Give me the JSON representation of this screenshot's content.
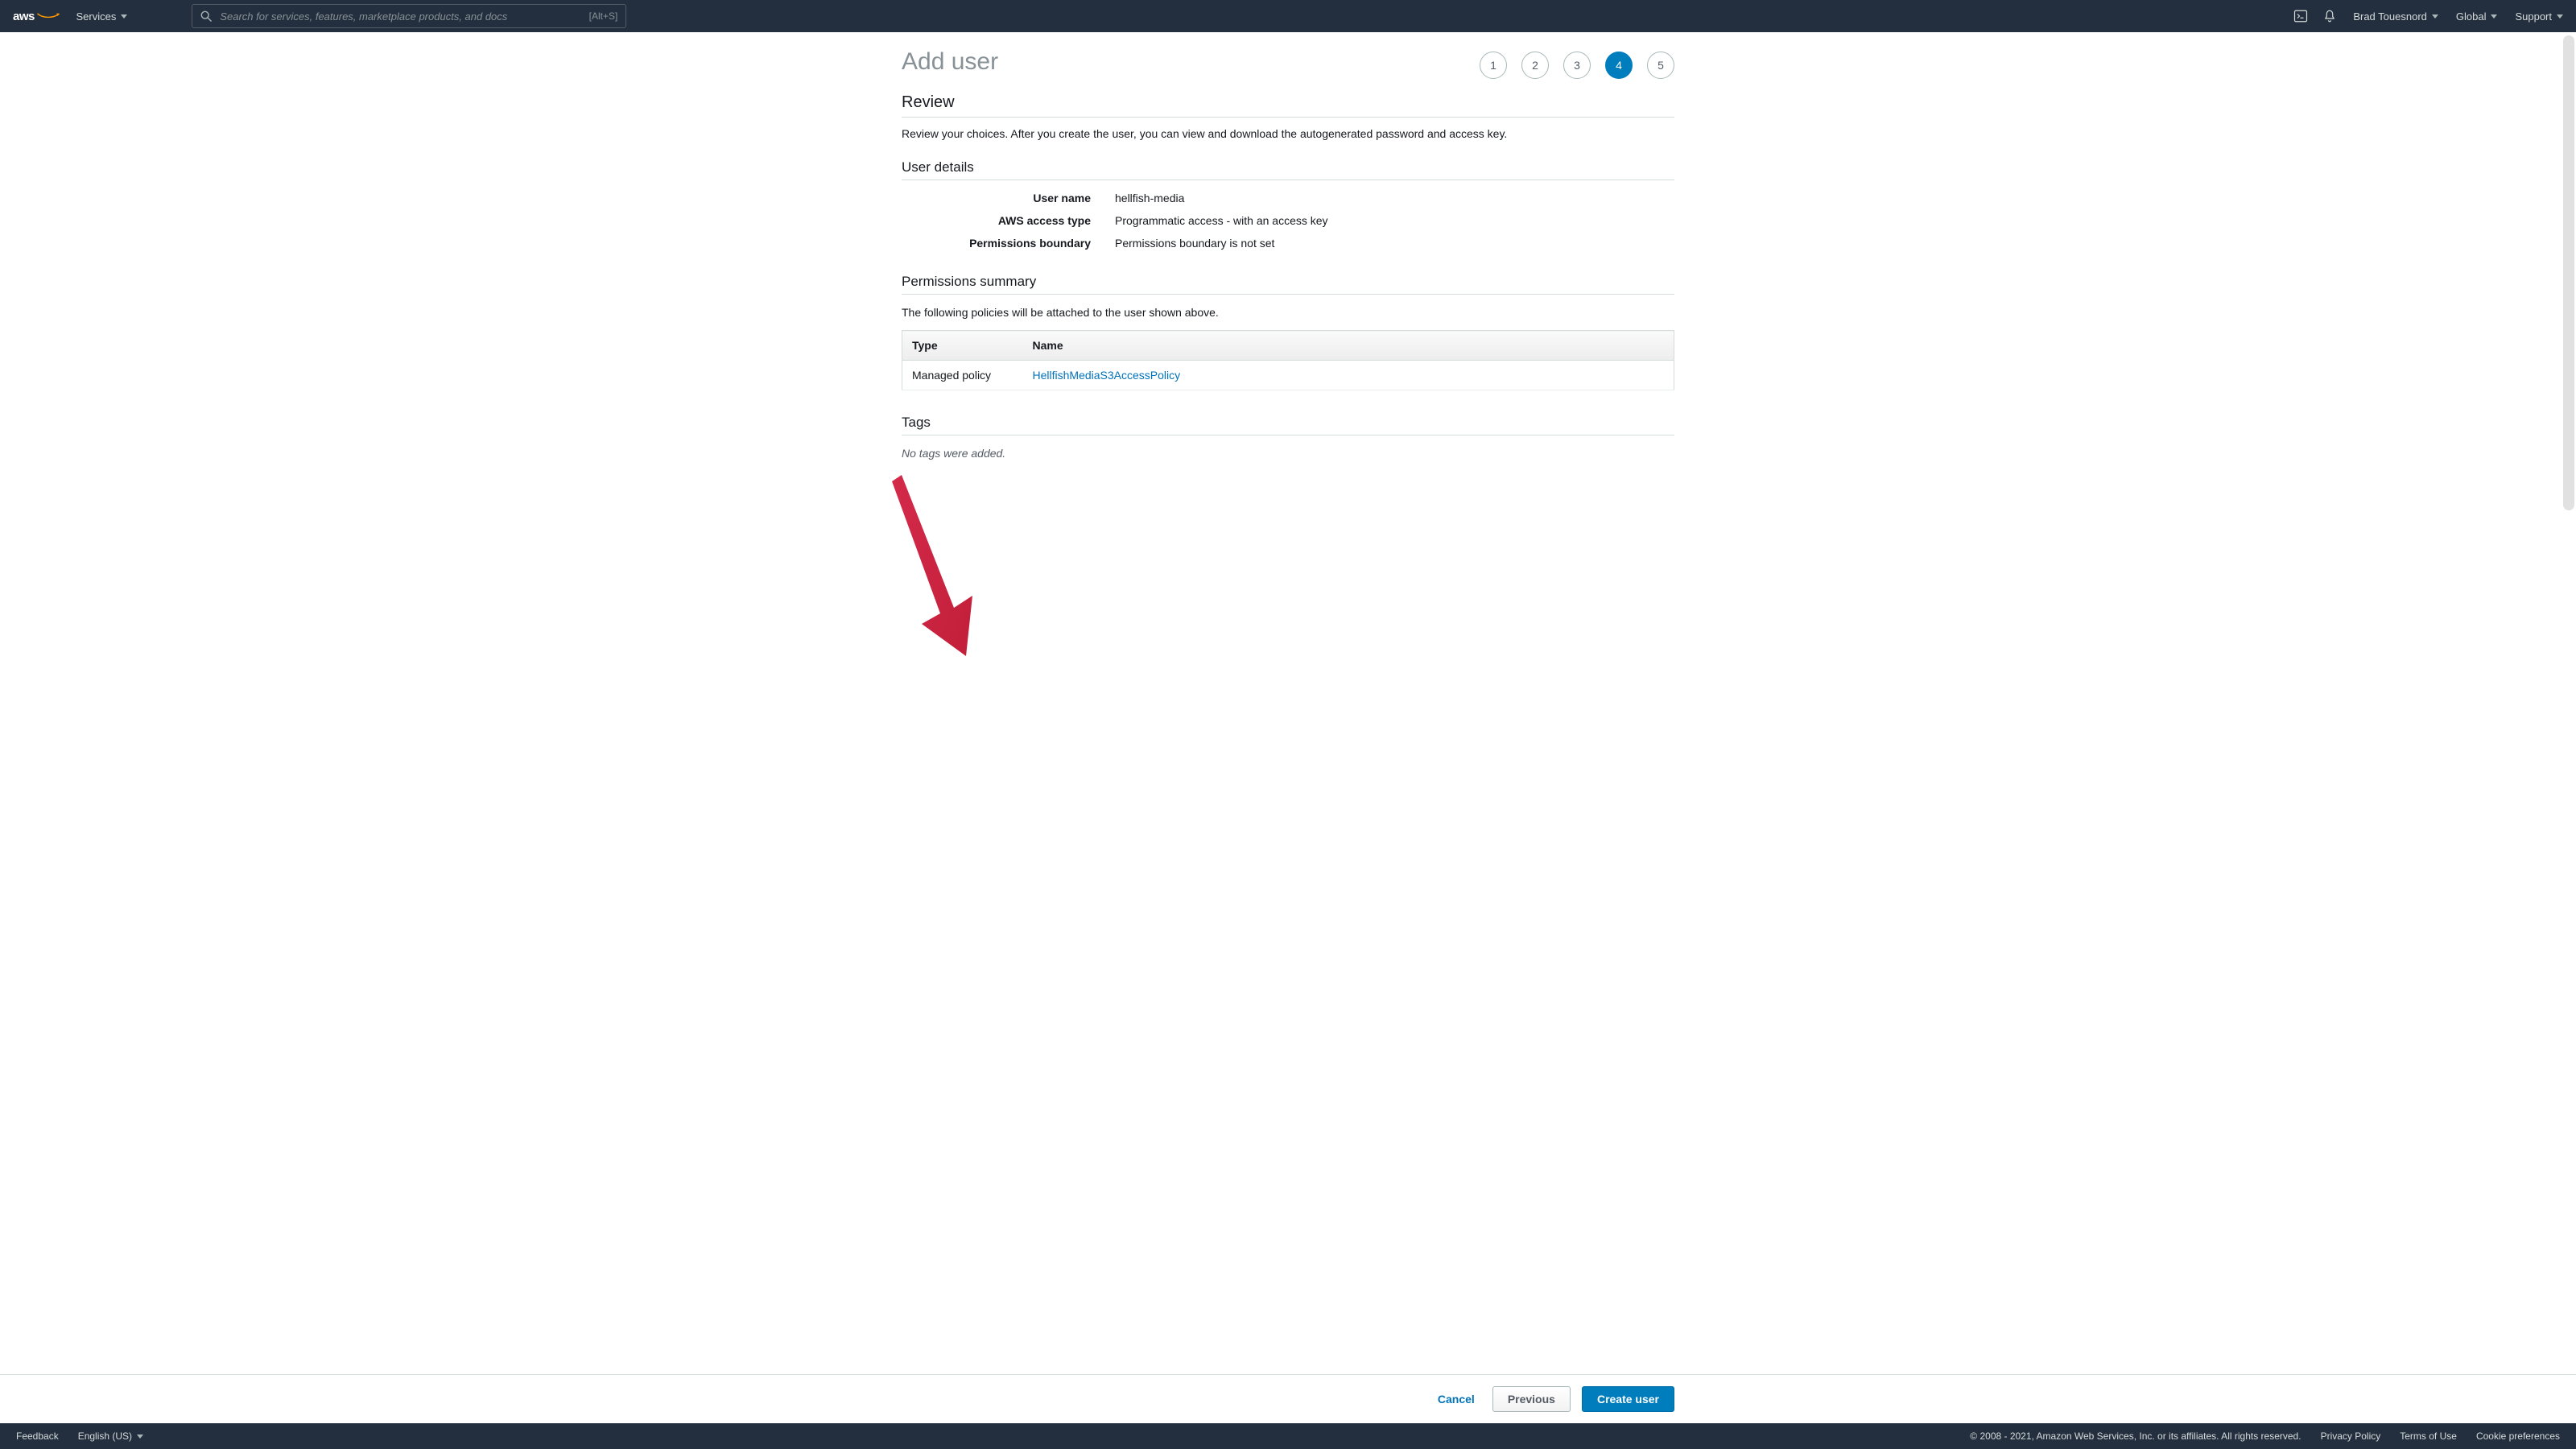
{
  "nav": {
    "services": "Services",
    "search_placeholder": "Search for services, features, marketplace products, and docs",
    "search_hint": "[Alt+S]",
    "user": "Brad Touesnord",
    "region": "Global",
    "support": "Support"
  },
  "page": {
    "title": "Add user",
    "steps": [
      "1",
      "2",
      "3",
      "4",
      "5"
    ],
    "active_step_index": 3
  },
  "review": {
    "heading": "Review",
    "subtext": "Review your choices. After you create the user, you can view and download the autogenerated password and access key."
  },
  "user_details": {
    "heading": "User details",
    "rows": [
      {
        "label": "User name",
        "value": "hellfish-media"
      },
      {
        "label": "AWS access type",
        "value": "Programmatic access - with an access key"
      },
      {
        "label": "Permissions boundary",
        "value": "Permissions boundary is not set"
      }
    ]
  },
  "permissions": {
    "heading": "Permissions summary",
    "desc": "The following policies will be attached to the user shown above.",
    "columns": [
      "Type",
      "Name"
    ],
    "rows": [
      {
        "type": "Managed policy",
        "name": "HellfishMediaS3AccessPolicy"
      }
    ]
  },
  "tags": {
    "heading": "Tags",
    "empty": "No tags were added."
  },
  "buttons": {
    "cancel": "Cancel",
    "previous": "Previous",
    "create": "Create user"
  },
  "footer": {
    "feedback": "Feedback",
    "language": "English (US)",
    "copyright": "© 2008 - 2021, Amazon Web Services, Inc. or its affiliates. All rights reserved.",
    "privacy": "Privacy Policy",
    "terms": "Terms of Use",
    "cookies": "Cookie preferences"
  }
}
